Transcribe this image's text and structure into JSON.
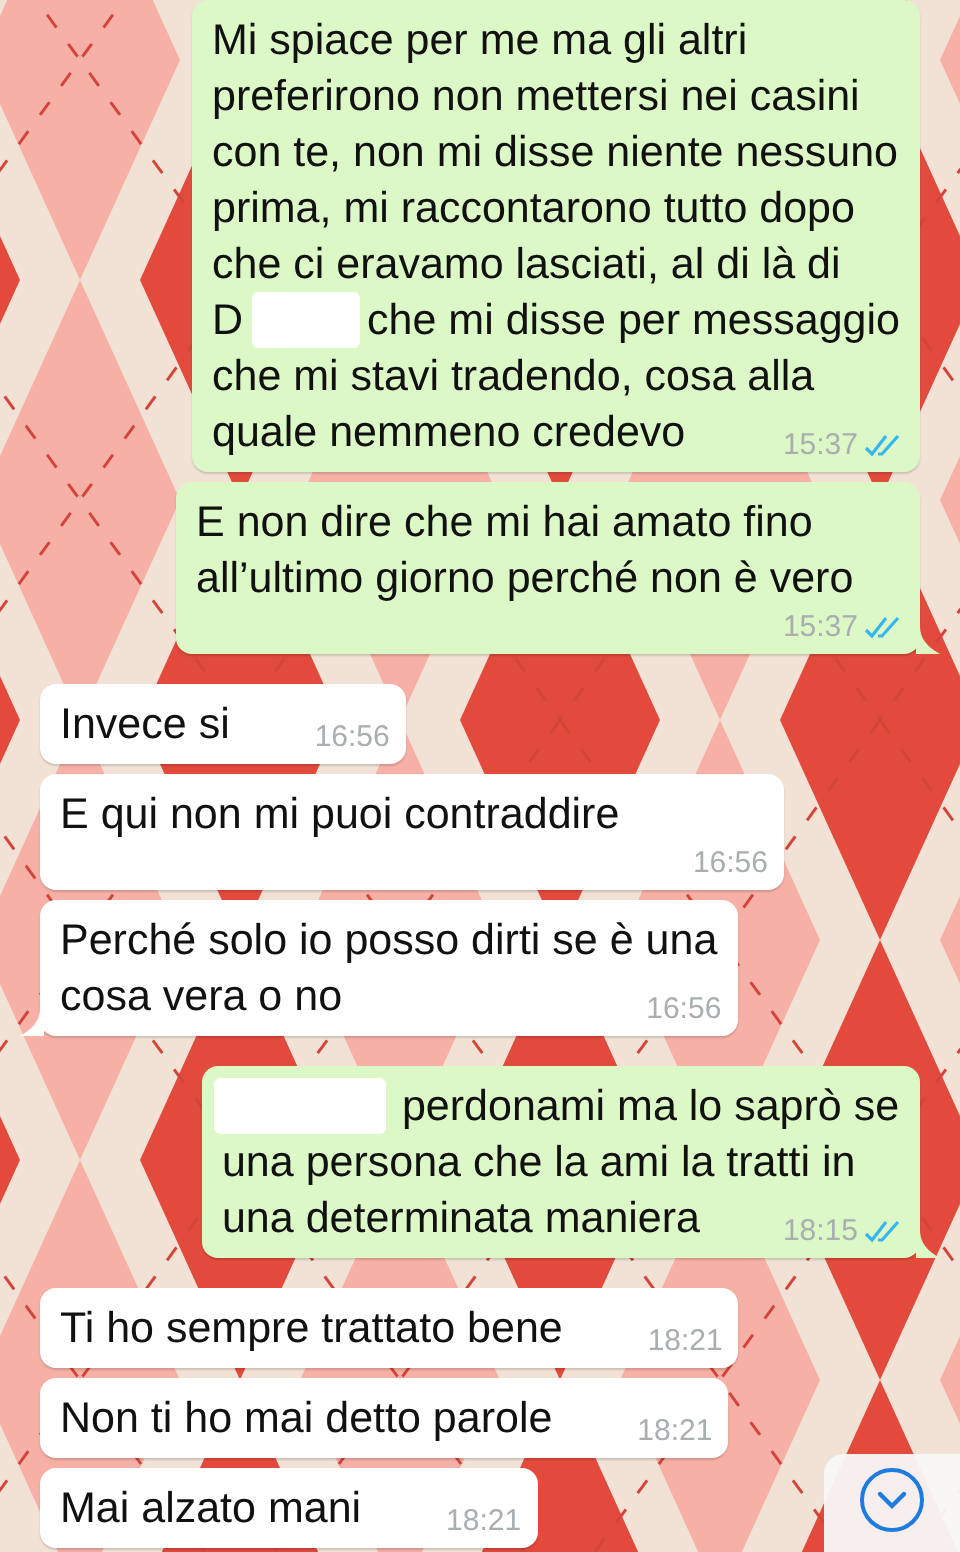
{
  "messages": [
    {
      "kind": "outgoing",
      "lines": [
        [
          {
            "kind": "text",
            "text": "Mi spiace per me ma gli altri"
          }
        ],
        [
          {
            "kind": "text",
            "text": "preferirono non mettersi nei casini"
          }
        ],
        [
          {
            "kind": "text",
            "text": "con te, non mi disse niente nessuno"
          }
        ],
        [
          {
            "kind": "text",
            "text": "prima, mi raccontarono tutto dopo"
          }
        ],
        [
          {
            "kind": "text",
            "text": "che ci eravamo lasciati, al di là di"
          }
        ],
        [
          {
            "kind": "text",
            "text": "D"
          },
          {
            "kind": "redacted"
          },
          {
            "kind": "text",
            "text": "che mi disse per messaggio"
          }
        ],
        [
          {
            "kind": "text",
            "text": "che mi stavi tradendo, cosa alla"
          }
        ],
        [
          {
            "kind": "text",
            "text": "quale nemmeno credevo"
          }
        ]
      ],
      "time": "15:37",
      "read": true
    },
    {
      "kind": "outgoing",
      "lines": [
        [
          {
            "kind": "text",
            "text": "E non dire che mi hai amato fino"
          }
        ],
        [
          {
            "kind": "text",
            "text": "all’ultimo giorno perché non è vero"
          }
        ]
      ],
      "time": "15:37",
      "read": true
    },
    {
      "kind": "incoming",
      "lines": [
        [
          {
            "kind": "text",
            "text": "Invece si"
          }
        ]
      ],
      "time": "16:56"
    },
    {
      "kind": "incoming",
      "lines": [
        [
          {
            "kind": "text",
            "text": "E qui non mi puoi contraddire"
          }
        ]
      ],
      "time": "16:56"
    },
    {
      "kind": "incoming",
      "lines": [
        [
          {
            "kind": "text",
            "text": "Perché solo io posso dirti se è una"
          }
        ],
        [
          {
            "kind": "text",
            "text": "cosa vera o no"
          }
        ]
      ],
      "time": "16:56"
    },
    {
      "kind": "outgoing",
      "lines": [
        [
          {
            "kind": "redacted"
          },
          {
            "kind": "text",
            "text": "perdonami ma lo saprò se"
          }
        ],
        [
          {
            "kind": "text",
            "text": "una persona che la ami la tratti in"
          }
        ],
        [
          {
            "kind": "text",
            "text": "una determinata maniera"
          }
        ]
      ],
      "time": "18:15",
      "read": true
    },
    {
      "kind": "incoming",
      "lines": [
        [
          {
            "kind": "text",
            "text": "Ti ho sempre trattato bene"
          }
        ]
      ],
      "time": "18:21"
    },
    {
      "kind": "incoming",
      "lines": [
        [
          {
            "kind": "text",
            "text": "Non ti ho mai detto parole"
          }
        ]
      ],
      "time": "18:21"
    },
    {
      "kind": "incoming",
      "lines": [
        [
          {
            "kind": "text",
            "text": "Mai alzato mani"
          }
        ]
      ],
      "time": "18:21"
    }
  ]
}
